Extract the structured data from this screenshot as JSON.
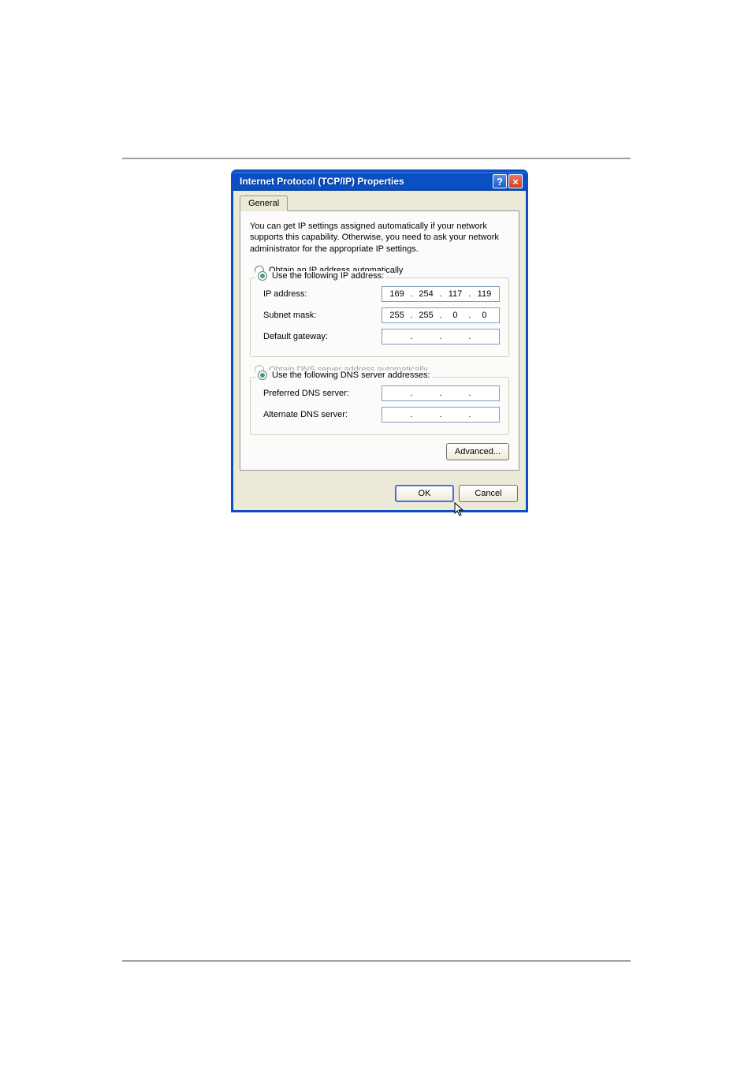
{
  "titlebar": {
    "title": "Internet Protocol (TCP/IP) Properties",
    "help_symbol": "?",
    "close_symbol": "×"
  },
  "tab": {
    "general": "General"
  },
  "description": "You can get IP settings assigned automatically if your network supports this capability. Otherwise, you need to ask your network administrator for the appropriate IP settings.",
  "ip_section": {
    "auto_label": "Obtain an IP address automatically",
    "manual_label": "Use the following IP address:",
    "ip_label": "IP address:",
    "subnet_label": "Subnet mask:",
    "gateway_label": "Default gateway:",
    "ip_value": {
      "a": "169",
      "b": "254",
      "c": "117",
      "d": "119"
    },
    "subnet_value": {
      "a": "255",
      "b": "255",
      "c": "0",
      "d": "0"
    },
    "gateway_value": {
      "a": "",
      "b": "",
      "c": "",
      "d": ""
    }
  },
  "dns_section": {
    "auto_label": "Obtain DNS server address automatically",
    "manual_label": "Use the following DNS server addresses:",
    "preferred_label": "Preferred DNS server:",
    "alternate_label": "Alternate DNS server:",
    "preferred_value": {
      "a": "",
      "b": "",
      "c": "",
      "d": ""
    },
    "alternate_value": {
      "a": "",
      "b": "",
      "c": "",
      "d": ""
    }
  },
  "buttons": {
    "advanced": "Advanced...",
    "ok": "OK",
    "cancel": "Cancel"
  },
  "dot": "."
}
